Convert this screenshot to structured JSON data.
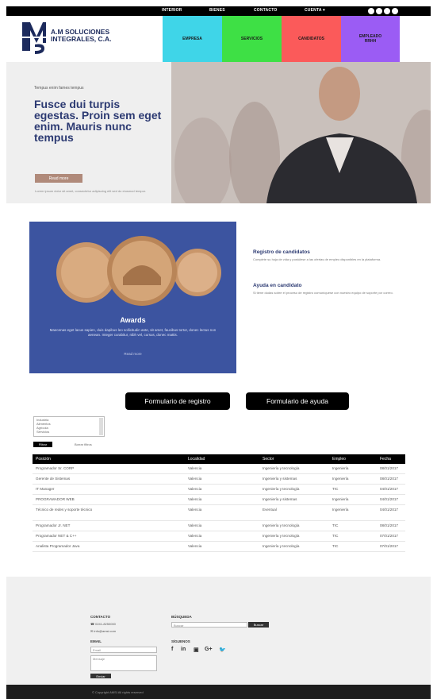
{
  "topbar": {
    "nav": [
      "INTERIOR",
      "BIENES",
      "CONTACTO",
      "CUENTA ▾"
    ],
    "social_icons": [
      "facebook-icon",
      "twitter-icon",
      "google-plus-icon",
      "linkedin-icon"
    ]
  },
  "header": {
    "logo_lines": [
      "A.M SOLUCIONES",
      "INTEGRALES, C.A."
    ],
    "tiles": [
      {
        "label": "EMPRESA",
        "color": "#3fd5e8"
      },
      {
        "label": "SERVICIOS",
        "color": "#3ee045"
      },
      {
        "label": "CANDIDATOS",
        "color": "#fb5a5a"
      },
      {
        "label": "EMPLEADO",
        "label2": "RRHH",
        "color": "#9b5cf4"
      }
    ]
  },
  "hero": {
    "kicker": "Tempus enim fames tempus",
    "title": "Fusce dui turpis egestas. Proin sem eget enim. Mauris nunc tempus",
    "button": "Read more",
    "note": "Lorem ipsum dolor sit amet, consectetur adipiscing elit sed do eiusmod tempor."
  },
  "awards": {
    "title": "Awards",
    "text": "Maecenas eget lacus sapien, duis dapibus leo sollicitudin ante, sit amet, faucibus tortor, donec lectus non aenean. Integer curabitur, nibh vel, cursus, donec mattis.",
    "link": "Read more"
  },
  "side": [
    {
      "title": "Registro de candidatos",
      "text": "Complete su hoja de vida y postúlese a las ofertas de empleo disponibles en la plataforma."
    },
    {
      "title": "Ayuda en candidato",
      "text": "Si tiene dudas sobre el proceso de registro comuníquese con nuestro equipo de soporte por correo."
    }
  ],
  "forms": {
    "register": "Formulario de registro",
    "help": "Formulario de ayuda"
  },
  "filter": {
    "options": [
      "Industria",
      "Alimentos",
      "Agrícola",
      "Servicios"
    ],
    "button": "Filtrar",
    "link": "Borrar filtros"
  },
  "table": {
    "headers": [
      "Posición",
      "Localidad",
      "Sector",
      "Empleo",
      "Fecha"
    ],
    "rows": [
      [
        "Programador Sr. CORP",
        "Valencia",
        "Ingeniería y tecnología",
        "Ingeniería",
        "08/01/2017"
      ],
      [
        "Gerente de Sistemas",
        "Valencia",
        "Ingeniería y sistemas",
        "Ingeniería",
        "08/01/2017"
      ],
      [
        "IT Manager",
        "Valencia",
        "Ingeniería y tecnología",
        "TIC",
        "04/01/2017"
      ],
      [
        "PROGRAMADOR WEB",
        "Valencia",
        "Ingeniería y sistemas",
        "Ingeniería",
        "04/01/2017"
      ],
      [
        "Técnico de redes y soporte técnico",
        "Valencia",
        "Eventual",
        "Ingeniería",
        "04/01/2017"
      ],
      [
        "Programador Jr. NET",
        "Valencia",
        "Ingeniería y tecnología",
        "TIC",
        "08/01/2017"
      ],
      [
        "Programador NET & C++",
        "Valencia",
        "Ingeniería y tecnología",
        "TIC",
        "07/01/2017"
      ],
      [
        "Analista Programador Java",
        "Valencia",
        "Ingeniería y tecnología",
        "TIC",
        "07/01/2017"
      ]
    ]
  },
  "footer": {
    "contact_label": "CONTACTO",
    "phone": "0241-8250000",
    "mail": "info@amsi.com",
    "email_label": "EMAIL",
    "email_placeholder": "Email",
    "message_placeholder": "Mensaje",
    "send": "Enviar",
    "search_label": "BÚSQUEDA",
    "search_placeholder": "Buscar",
    "search_button": "Buscar",
    "follow_label": "SÍGUENOS",
    "social": [
      "f",
      "in",
      "▣",
      "G+",
      "🐦"
    ],
    "copyright": "© Copyright AMSI All rights reserved"
  }
}
